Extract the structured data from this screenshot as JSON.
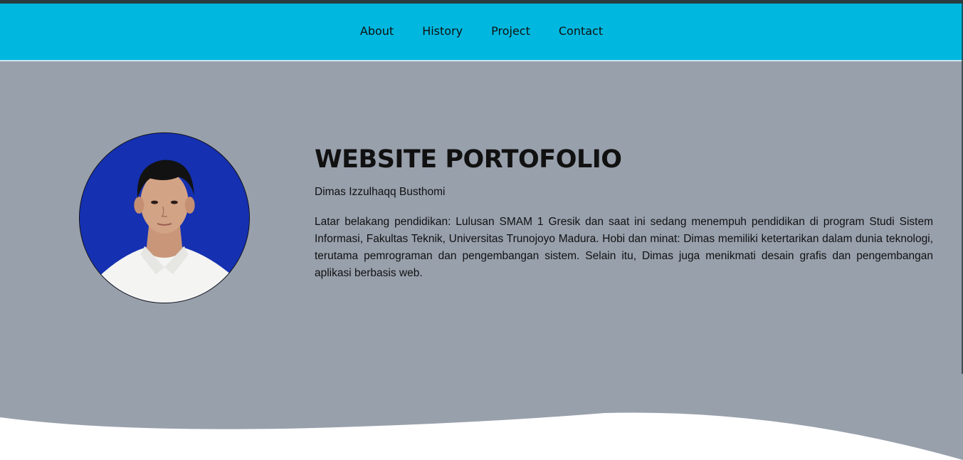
{
  "nav": {
    "items": [
      {
        "label": "About"
      },
      {
        "label": "History"
      },
      {
        "label": "Project"
      },
      {
        "label": "Contact"
      }
    ]
  },
  "hero": {
    "title": "WEBSITE PORTOFOLIO",
    "name": "Dimas Izzulhaqq Busthomi",
    "description": "Latar belakang pendidikan: Lulusan SMAM 1 Gresik dan saat ini sedang menempuh pendidikan di program Studi Sistem Informasi, Fakultas Teknik, Universitas Trunojoyo Madura. Hobi dan minat: Dimas memiliki ketertarikan dalam dunia teknologi, terutama pemrograman dan pengembangan sistem. Selain itu, Dimas juga menikmati desain grafis dan pengembangan aplikasi berbasis web."
  },
  "colors": {
    "navbar": "#00b8df",
    "hero_background": "#98a0ac",
    "photo_background": "#1530b0"
  }
}
